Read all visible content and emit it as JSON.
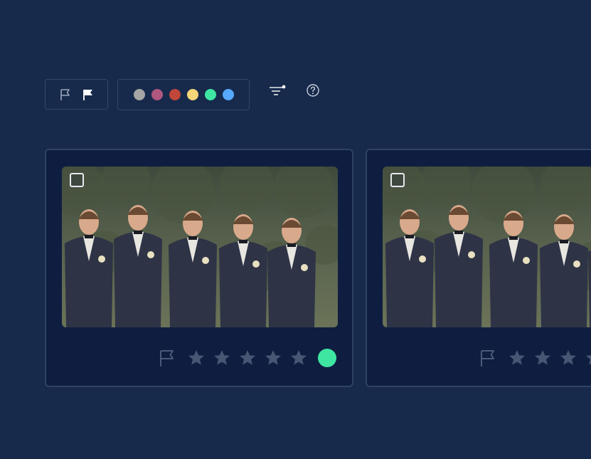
{
  "toolbar": {
    "flags": [
      {
        "name": "unflagged",
        "icon": "flag-outline-icon",
        "color": "#9aa6ba"
      },
      {
        "name": "flagged",
        "icon": "flag-filled-icon",
        "color": "#ffffff"
      }
    ],
    "color_labels": [
      "#a6a6a6",
      "#b0577f",
      "#c0473a",
      "#f4d678",
      "#3ee6a2",
      "#55a9ff"
    ],
    "filter_icon": "filter-icon",
    "help_icon": "help-icon"
  },
  "cards": [
    {
      "image": "groomsmen-photo",
      "selected": false,
      "flag_icon": "flag-outline-icon",
      "rating": 0,
      "max_rating": 5,
      "label_color": "#3ee6a2"
    },
    {
      "image": "groomsmen-photo",
      "selected": false,
      "flag_icon": "flag-outline-icon",
      "rating": 0,
      "max_rating": 5,
      "label_color": "#3ee6a2"
    }
  ]
}
